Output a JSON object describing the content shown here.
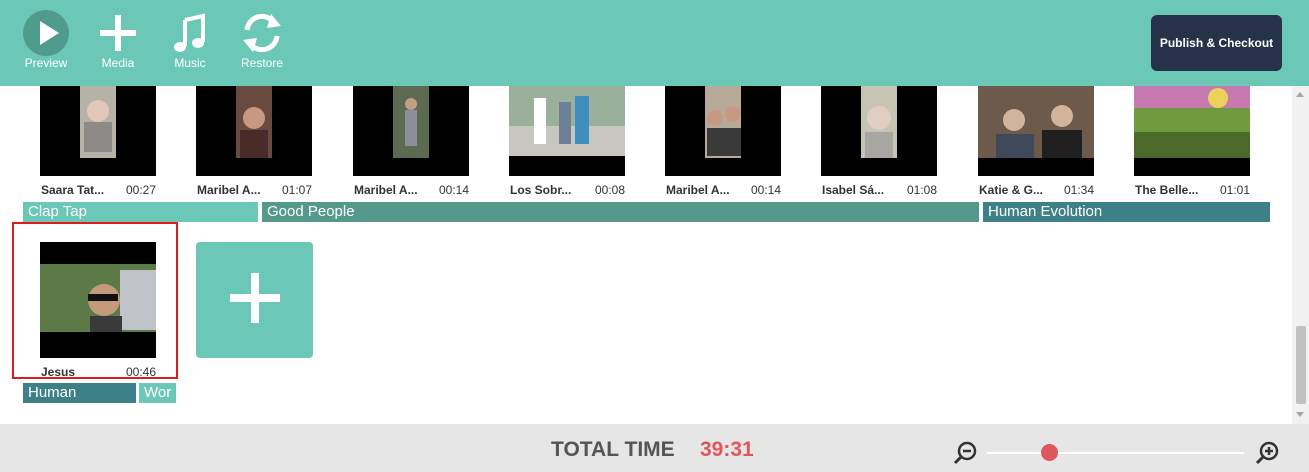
{
  "toolbar": {
    "preview_label": "Preview",
    "media_label": "Media",
    "music_label": "Music",
    "restore_label": "Restore",
    "publish_label": "Publish & Checkout"
  },
  "clips_row1": [
    {
      "name": "Saara Tat...",
      "duration": "00:27"
    },
    {
      "name": "Maribel A...",
      "duration": "01:07"
    },
    {
      "name": "Maribel A...",
      "duration": "00:14"
    },
    {
      "name": "Los Sobr...",
      "duration": "00:08"
    },
    {
      "name": "Maribel A...",
      "duration": "00:14"
    },
    {
      "name": "Isabel Sá...",
      "duration": "01:08"
    },
    {
      "name": "Katie & G...",
      "duration": "01:34"
    },
    {
      "name": "The Belle...",
      "duration": "01:01"
    }
  ],
  "music_row1": [
    {
      "label": "Clap Tap"
    },
    {
      "label": "Good People"
    },
    {
      "label": "Human Evolution"
    }
  ],
  "clips_row2": [
    {
      "name": "Jesus",
      "duration": "00:46"
    }
  ],
  "music_row2": [
    {
      "label": "Human"
    },
    {
      "label": "Wor"
    }
  ],
  "footer": {
    "total_label": "TOTAL TIME",
    "total_value": "39:31",
    "zoom_level": 0.24
  },
  "colors": {
    "accent": "#6cc8b6",
    "publish_bg": "#263248",
    "total_time": "#e0575b",
    "music_light": "#6cc8b6",
    "music_mid": "#55998d",
    "music_dark": "#3e8088",
    "selected_border": "#e01b1b"
  }
}
